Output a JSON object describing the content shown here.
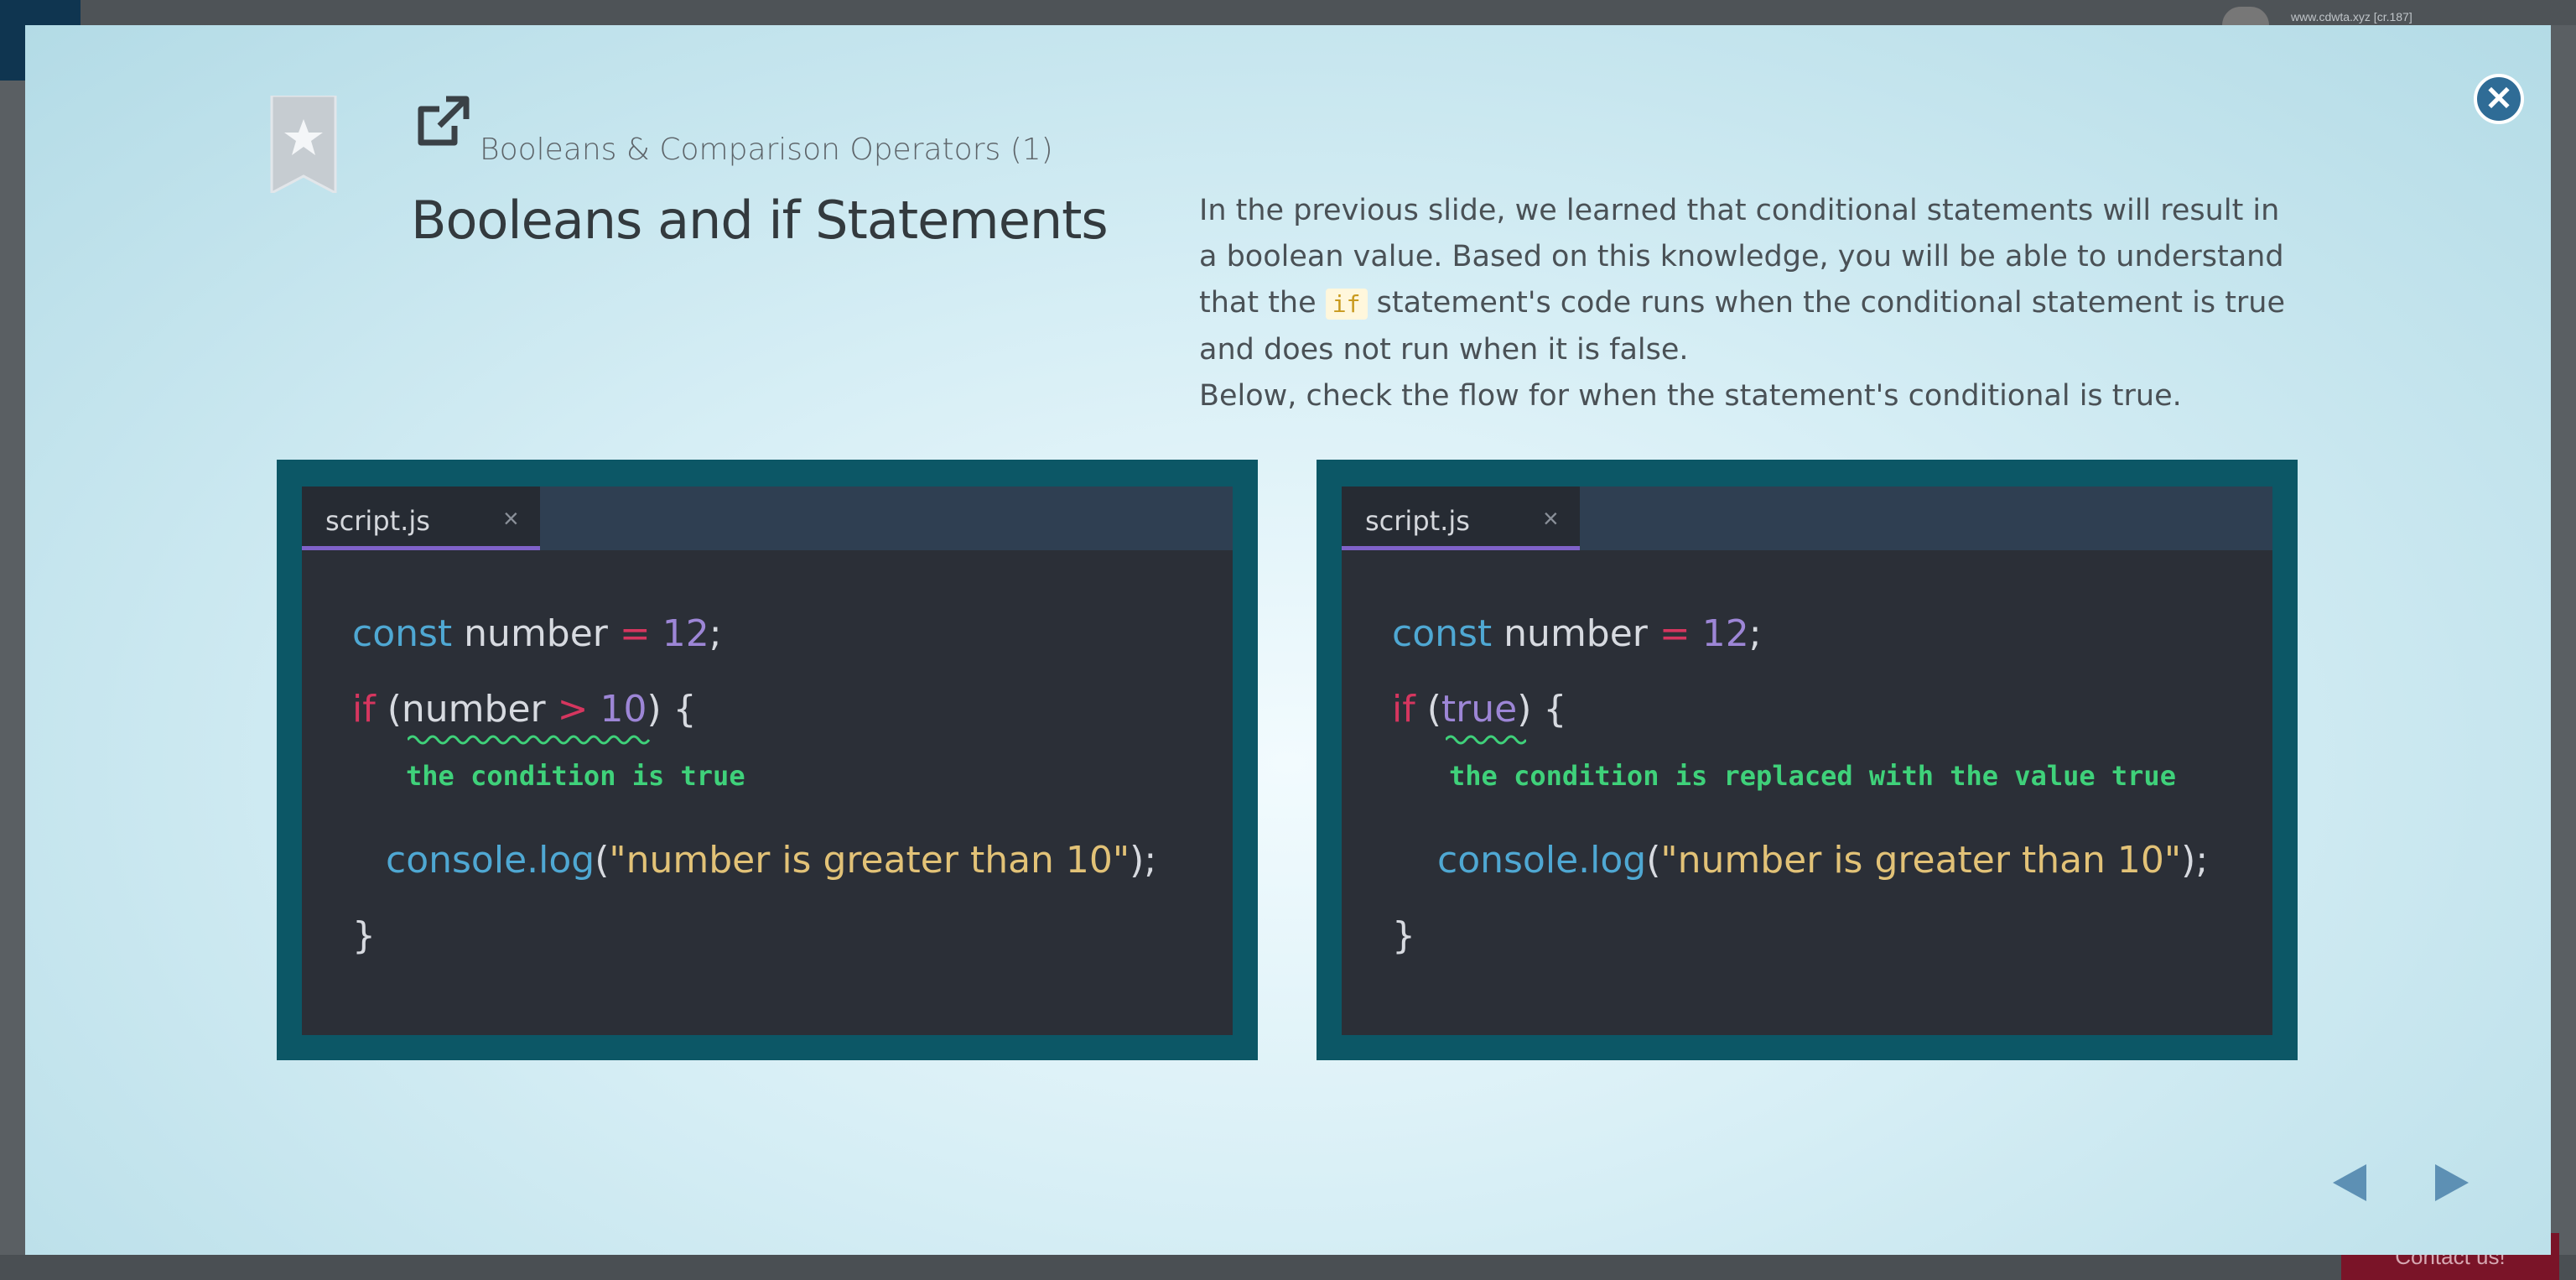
{
  "background": {
    "url": "www.cdwta.xyz [cr.187]",
    "contact_label": "Contact us!"
  },
  "header": {
    "subtitle": "Booleans & Comparison Operators (1)",
    "title": "Booleans and if Statements"
  },
  "description": {
    "line1": "In the previous slide, we learned that conditional statements will result in a boolean value. Based on this knowledge, you will be able to understand that the ",
    "inline_code": "if",
    "line1_rest": " statement's code runs when the conditional statement is true and does not run when it is false.",
    "line2": "Below, check the flow for when the statement's conditional is true."
  },
  "left_editor": {
    "tab_label": "script.js",
    "tab_close": "×",
    "line1": {
      "kw": "const",
      "name": " number ",
      "op": "=",
      "num": " 12",
      "end": ";"
    },
    "line2": {
      "kw": "if",
      "open": " (",
      "name": "number ",
      "op": ">",
      "num": " 10",
      "close": ") {"
    },
    "note": "the condition is true",
    "line3": {
      "fn": "console.log",
      "open": "(",
      "str": "\"number is greater than 10\"",
      "close": ");"
    },
    "line4": "}"
  },
  "right_editor": {
    "tab_label": "script.js",
    "tab_close": "×",
    "line1": {
      "kw": "const",
      "name": " number ",
      "op": "=",
      "num": " 12",
      "end": ";"
    },
    "line2": {
      "kw": "if",
      "open": " (",
      "val": "true",
      "close": ") {"
    },
    "note": "the condition is replaced with the value true",
    "line3": {
      "fn": "console.log",
      "open": "(",
      "str": "\"number is greater than 10\"",
      "close": ");"
    },
    "line4": "}"
  },
  "colors": {
    "panel": "#0c5766",
    "editor": "#2b2f37",
    "keyword": "#4fa8d3",
    "if_keyword": "#d6365f",
    "number": "#9d86d6",
    "string": "#e2c277",
    "note": "#3fd17a",
    "close_button": "#2f6c96",
    "nav_arrow": "#5d90b4"
  },
  "icons": {
    "close": "close-icon",
    "bookmark": "bookmark-star-icon",
    "external": "external-link-icon",
    "prev": "prev-arrow-icon",
    "next": "next-arrow-icon"
  }
}
